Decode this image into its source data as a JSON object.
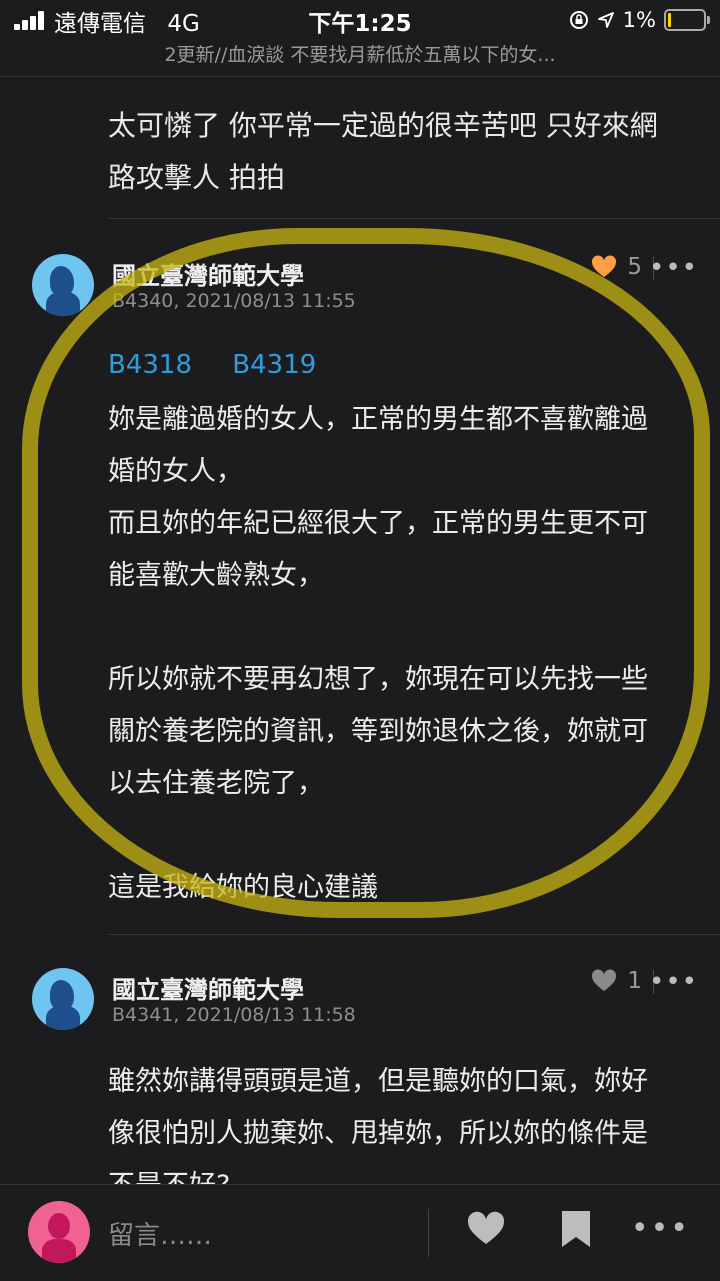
{
  "status_bar": {
    "carrier": "遠傳電信",
    "network": "4G",
    "time": "下午1:25",
    "battery_percent": "1%",
    "battery_level": 0.01
  },
  "header": {
    "subtitle": "2更新//血淚談 不要找月薪低於五萬以下的女..."
  },
  "previous_comment": {
    "lines": [
      "太可憐了 你平常一定過的很辛苦吧 只好來網",
      "路攻擊人 拍拍"
    ]
  },
  "comments": [
    {
      "author": "國立臺灣師範大學",
      "meta": "B4340, 2021/08/13 11:55",
      "likes": "5",
      "liked": true,
      "refs": [
        "B4318",
        "B4319"
      ],
      "body": "妳是離過婚的女人，正常的男生都不喜歡離過\n婚的女人，\n而且妳的年紀已經很大了，正常的男生更不可\n能喜歡大齡熟女，\n\n所以妳就不要再幻想了，妳現在可以先找一些\n關於養老院的資訊，等到妳退休之後，妳就可\n以去住養老院了，\n\n這是我給妳的良心建議"
    },
    {
      "author": "國立臺灣師範大學",
      "meta": "B4341, 2021/08/13 11:58",
      "likes": "1",
      "liked": false,
      "body": "雖然妳講得頭頭是道，但是聽妳的口氣，妳好\n像很怕別人拋棄妳、甩掉妳，所以妳的條件是\n不是不好?"
    }
  ],
  "bottom_bar": {
    "comment_placeholder": "留言……"
  },
  "colors": {
    "background": "#1c1c1e",
    "link": "#2f9cdc",
    "liked_heart": "#ff9f43",
    "highlight": "#c8b414"
  },
  "icons": [
    "signal-icon",
    "lock-rotation-icon",
    "location-arrow-icon",
    "battery-icon",
    "heart-icon",
    "more-icon",
    "bookmark-icon",
    "user-avatar-icon"
  ]
}
